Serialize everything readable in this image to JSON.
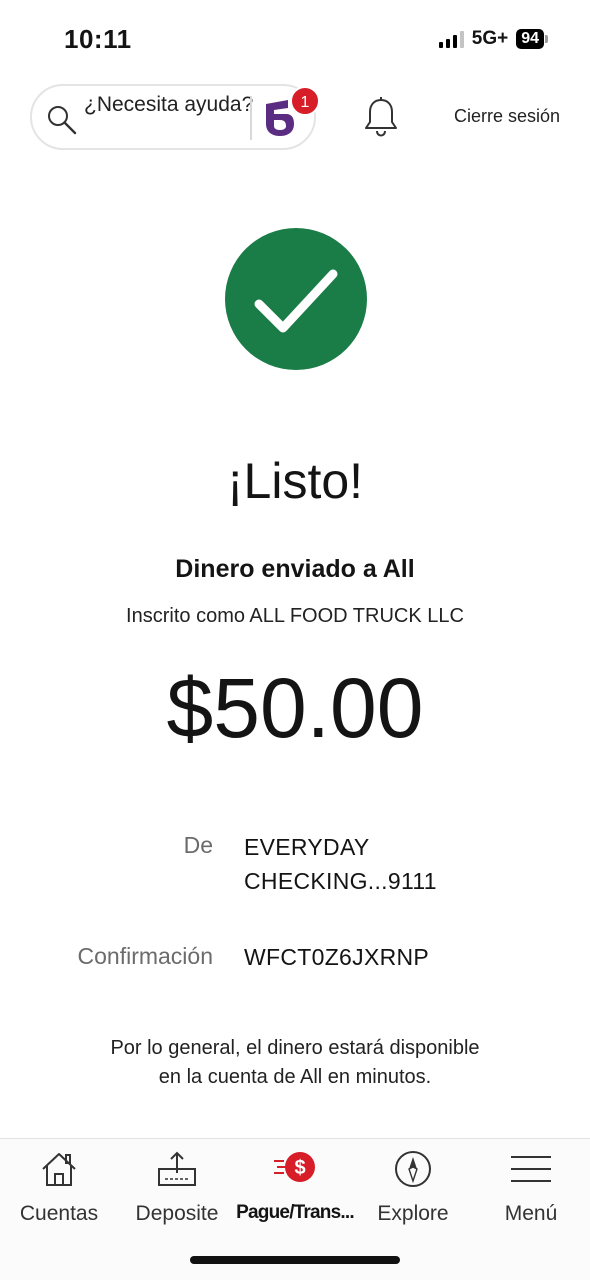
{
  "status_bar": {
    "time": "10:11",
    "network": "5G+",
    "battery": "94"
  },
  "header": {
    "search_text": "¿Necesita ayuda?",
    "assistant_badge_count": "1",
    "logout_label": "Cierre sesión"
  },
  "confirmation": {
    "title": "¡Listo!",
    "sent_to": "Dinero enviado a All",
    "enrolled_as": "Inscrito como ALL FOOD TRUCK LLC",
    "amount": "$50.00",
    "from_label": "De",
    "from_value": "EVERYDAY CHECKING...9111",
    "confirmation_label": "Confirmación",
    "confirmation_value": "WFCT0Z6JXRNP",
    "availability_note": "Por lo general, el dinero estará disponible en la cuenta de All en minutos."
  },
  "bottom_nav": {
    "items": [
      {
        "label": "Cuentas",
        "icon": "home-icon"
      },
      {
        "label": "Deposite",
        "icon": "deposit-icon"
      },
      {
        "label": "Pague/Trans...",
        "icon": "pay-transfer-icon",
        "active": true
      },
      {
        "label": "Explore",
        "icon": "compass-icon"
      },
      {
        "label": "Menú",
        "icon": "menu-icon"
      }
    ]
  },
  "colors": {
    "success_green": "#1a7c46",
    "badge_red": "#d71e28",
    "assistant_purple": "#5b2d82",
    "accent_red": "#d71e28"
  }
}
